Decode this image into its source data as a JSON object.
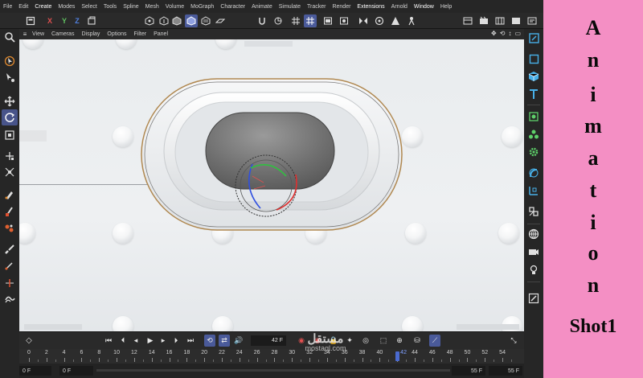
{
  "menu": [
    "File",
    "Edit",
    "Create",
    "Modes",
    "Select",
    "Tools",
    "Spline",
    "Mesh",
    "Volume",
    "MoGraph",
    "Character",
    "Animate",
    "Simulate",
    "Tracker",
    "Render",
    "Extensions",
    "Arnold",
    "Window",
    "Help"
  ],
  "toolbar": {
    "axis_x": "X",
    "axis_y": "Y",
    "axis_z": "Z"
  },
  "viewport_menu": [
    "View",
    "Cameras",
    "Display",
    "Options",
    "Filter",
    "Panel"
  ],
  "timeline": {
    "current_frame": "42 F",
    "ruler_ticks": [
      "0",
      "2",
      "4",
      "6",
      "8",
      "10",
      "12",
      "14",
      "16",
      "18",
      "20",
      "22",
      "24",
      "26",
      "28",
      "30",
      "32",
      "34",
      "36",
      "38",
      "40",
      "42",
      "44",
      "46",
      "48",
      "50",
      "52",
      "54"
    ],
    "playhead_frame": 42,
    "max_frame": 55,
    "range_start": "0 F",
    "range_min": "0 F",
    "range_end": "55 F",
    "range_max": "55 F"
  },
  "watermark": {
    "logo": "مستقل",
    "domain": "mostaql.com"
  },
  "side_panel": {
    "letters": [
      "A",
      "n",
      "i",
      "m",
      "a",
      "t",
      "i",
      "o",
      "n"
    ],
    "shot": "Shot1"
  },
  "colors": {
    "side_panel_bg": "#f48fc4",
    "selection": "#4a5a9a",
    "axis_x": "#e05050",
    "axis_y": "#60c060",
    "axis_z": "#5080e0"
  }
}
